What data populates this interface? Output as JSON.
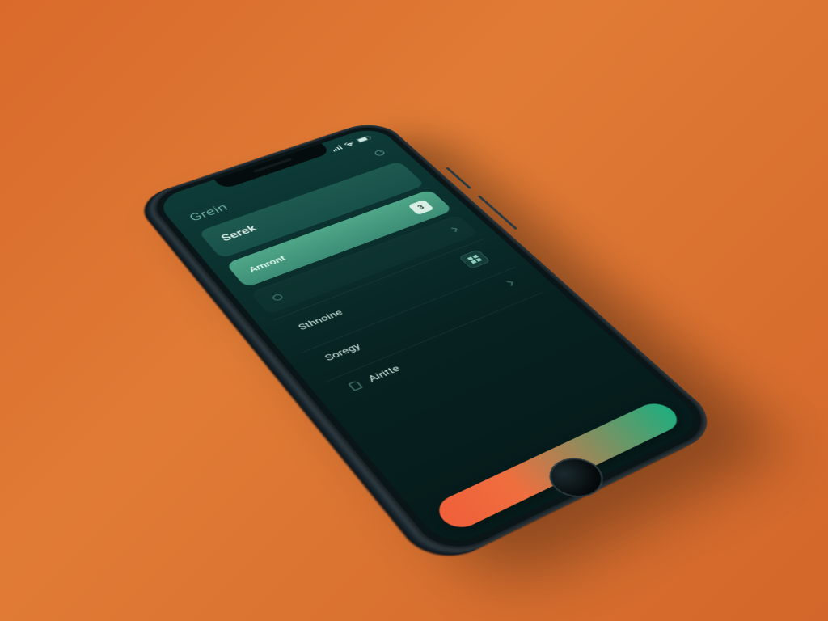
{
  "status": {
    "time": " "
  },
  "header": {
    "title": "Grein"
  },
  "primary_card": {
    "title": "Serek",
    "subtitle1": "",
    "subtitle2": ""
  },
  "highlight_card": {
    "label": "Arnront",
    "chip": "3"
  },
  "rows": [
    {
      "label": "",
      "label2": ""
    },
    {
      "label": "Sthnoine"
    },
    {
      "label": "Soregy"
    },
    {
      "label": "Airitte"
    }
  ],
  "cta": {
    "label": ""
  }
}
